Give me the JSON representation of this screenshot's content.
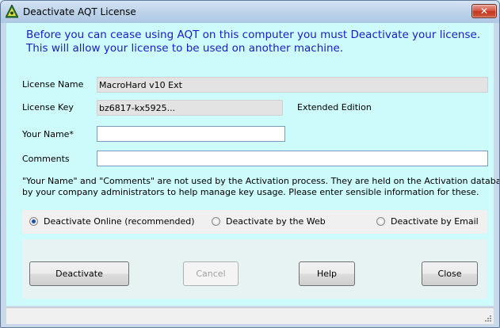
{
  "window": {
    "title": "Deactivate AQT License",
    "close_glyph": "✕",
    "icon": "aqt-app-icon"
  },
  "info": {
    "line1": "Before you can cease using AQT on this computer you must Deactivate your license.",
    "line2": "This will allow your license to be used on another machine."
  },
  "form": {
    "license_name_label": "License Name",
    "license_name_value": "MacroHard v10 Ext",
    "license_key_label": "License Key",
    "license_key_value": "bz6817-kx5925...",
    "edition": "Extended Edition",
    "your_name_label": "Your Name*",
    "your_name_value": "",
    "comments_label": "Comments",
    "comments_value": ""
  },
  "note": {
    "line1": "\"Your Name\" and \"Comments\" are not used by the Activation process. They are held on the Activation database and used",
    "line2": "by your company administrators to help manage key usage. Please enter sensible information for these."
  },
  "options": {
    "selected": "online",
    "online_label": "Deactivate Online (recommended)",
    "web_label": "Deactivate by the Web",
    "email_label": "Deactivate by Email"
  },
  "buttons": {
    "deactivate": "Deactivate",
    "cancel": "Cancel",
    "help": "Help",
    "close": "Close"
  },
  "colors": {
    "client_bg": "#cdfafa",
    "info_text": "#1a20c8"
  }
}
